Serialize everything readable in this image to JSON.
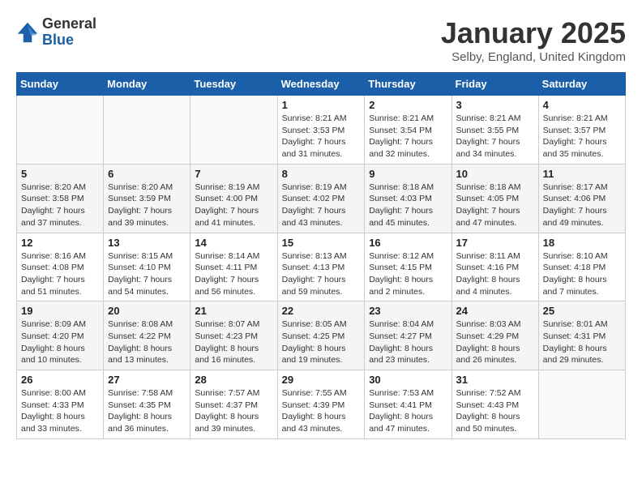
{
  "logo": {
    "general": "General",
    "blue": "Blue"
  },
  "title": "January 2025",
  "subtitle": "Selby, England, United Kingdom",
  "weekdays": [
    "Sunday",
    "Monday",
    "Tuesday",
    "Wednesday",
    "Thursday",
    "Friday",
    "Saturday"
  ],
  "weeks": [
    [
      {
        "day": "",
        "sunrise": "",
        "sunset": "",
        "daylight": ""
      },
      {
        "day": "",
        "sunrise": "",
        "sunset": "",
        "daylight": ""
      },
      {
        "day": "",
        "sunrise": "",
        "sunset": "",
        "daylight": ""
      },
      {
        "day": "1",
        "sunrise": "Sunrise: 8:21 AM",
        "sunset": "Sunset: 3:53 PM",
        "daylight": "Daylight: 7 hours and 31 minutes."
      },
      {
        "day": "2",
        "sunrise": "Sunrise: 8:21 AM",
        "sunset": "Sunset: 3:54 PM",
        "daylight": "Daylight: 7 hours and 32 minutes."
      },
      {
        "day": "3",
        "sunrise": "Sunrise: 8:21 AM",
        "sunset": "Sunset: 3:55 PM",
        "daylight": "Daylight: 7 hours and 34 minutes."
      },
      {
        "day": "4",
        "sunrise": "Sunrise: 8:21 AM",
        "sunset": "Sunset: 3:57 PM",
        "daylight": "Daylight: 7 hours and 35 minutes."
      }
    ],
    [
      {
        "day": "5",
        "sunrise": "Sunrise: 8:20 AM",
        "sunset": "Sunset: 3:58 PM",
        "daylight": "Daylight: 7 hours and 37 minutes."
      },
      {
        "day": "6",
        "sunrise": "Sunrise: 8:20 AM",
        "sunset": "Sunset: 3:59 PM",
        "daylight": "Daylight: 7 hours and 39 minutes."
      },
      {
        "day": "7",
        "sunrise": "Sunrise: 8:19 AM",
        "sunset": "Sunset: 4:00 PM",
        "daylight": "Daylight: 7 hours and 41 minutes."
      },
      {
        "day": "8",
        "sunrise": "Sunrise: 8:19 AM",
        "sunset": "Sunset: 4:02 PM",
        "daylight": "Daylight: 7 hours and 43 minutes."
      },
      {
        "day": "9",
        "sunrise": "Sunrise: 8:18 AM",
        "sunset": "Sunset: 4:03 PM",
        "daylight": "Daylight: 7 hours and 45 minutes."
      },
      {
        "day": "10",
        "sunrise": "Sunrise: 8:18 AM",
        "sunset": "Sunset: 4:05 PM",
        "daylight": "Daylight: 7 hours and 47 minutes."
      },
      {
        "day": "11",
        "sunrise": "Sunrise: 8:17 AM",
        "sunset": "Sunset: 4:06 PM",
        "daylight": "Daylight: 7 hours and 49 minutes."
      }
    ],
    [
      {
        "day": "12",
        "sunrise": "Sunrise: 8:16 AM",
        "sunset": "Sunset: 4:08 PM",
        "daylight": "Daylight: 7 hours and 51 minutes."
      },
      {
        "day": "13",
        "sunrise": "Sunrise: 8:15 AM",
        "sunset": "Sunset: 4:10 PM",
        "daylight": "Daylight: 7 hours and 54 minutes."
      },
      {
        "day": "14",
        "sunrise": "Sunrise: 8:14 AM",
        "sunset": "Sunset: 4:11 PM",
        "daylight": "Daylight: 7 hours and 56 minutes."
      },
      {
        "day": "15",
        "sunrise": "Sunrise: 8:13 AM",
        "sunset": "Sunset: 4:13 PM",
        "daylight": "Daylight: 7 hours and 59 minutes."
      },
      {
        "day": "16",
        "sunrise": "Sunrise: 8:12 AM",
        "sunset": "Sunset: 4:15 PM",
        "daylight": "Daylight: 8 hours and 2 minutes."
      },
      {
        "day": "17",
        "sunrise": "Sunrise: 8:11 AM",
        "sunset": "Sunset: 4:16 PM",
        "daylight": "Daylight: 8 hours and 4 minutes."
      },
      {
        "day": "18",
        "sunrise": "Sunrise: 8:10 AM",
        "sunset": "Sunset: 4:18 PM",
        "daylight": "Daylight: 8 hours and 7 minutes."
      }
    ],
    [
      {
        "day": "19",
        "sunrise": "Sunrise: 8:09 AM",
        "sunset": "Sunset: 4:20 PM",
        "daylight": "Daylight: 8 hours and 10 minutes."
      },
      {
        "day": "20",
        "sunrise": "Sunrise: 8:08 AM",
        "sunset": "Sunset: 4:22 PM",
        "daylight": "Daylight: 8 hours and 13 minutes."
      },
      {
        "day": "21",
        "sunrise": "Sunrise: 8:07 AM",
        "sunset": "Sunset: 4:23 PM",
        "daylight": "Daylight: 8 hours and 16 minutes."
      },
      {
        "day": "22",
        "sunrise": "Sunrise: 8:05 AM",
        "sunset": "Sunset: 4:25 PM",
        "daylight": "Daylight: 8 hours and 19 minutes."
      },
      {
        "day": "23",
        "sunrise": "Sunrise: 8:04 AM",
        "sunset": "Sunset: 4:27 PM",
        "daylight": "Daylight: 8 hours and 23 minutes."
      },
      {
        "day": "24",
        "sunrise": "Sunrise: 8:03 AM",
        "sunset": "Sunset: 4:29 PM",
        "daylight": "Daylight: 8 hours and 26 minutes."
      },
      {
        "day": "25",
        "sunrise": "Sunrise: 8:01 AM",
        "sunset": "Sunset: 4:31 PM",
        "daylight": "Daylight: 8 hours and 29 minutes."
      }
    ],
    [
      {
        "day": "26",
        "sunrise": "Sunrise: 8:00 AM",
        "sunset": "Sunset: 4:33 PM",
        "daylight": "Daylight: 8 hours and 33 minutes."
      },
      {
        "day": "27",
        "sunrise": "Sunrise: 7:58 AM",
        "sunset": "Sunset: 4:35 PM",
        "daylight": "Daylight: 8 hours and 36 minutes."
      },
      {
        "day": "28",
        "sunrise": "Sunrise: 7:57 AM",
        "sunset": "Sunset: 4:37 PM",
        "daylight": "Daylight: 8 hours and 39 minutes."
      },
      {
        "day": "29",
        "sunrise": "Sunrise: 7:55 AM",
        "sunset": "Sunset: 4:39 PM",
        "daylight": "Daylight: 8 hours and 43 minutes."
      },
      {
        "day": "30",
        "sunrise": "Sunrise: 7:53 AM",
        "sunset": "Sunset: 4:41 PM",
        "daylight": "Daylight: 8 hours and 47 minutes."
      },
      {
        "day": "31",
        "sunrise": "Sunrise: 7:52 AM",
        "sunset": "Sunset: 4:43 PM",
        "daylight": "Daylight: 8 hours and 50 minutes."
      },
      {
        "day": "",
        "sunrise": "",
        "sunset": "",
        "daylight": ""
      }
    ]
  ]
}
